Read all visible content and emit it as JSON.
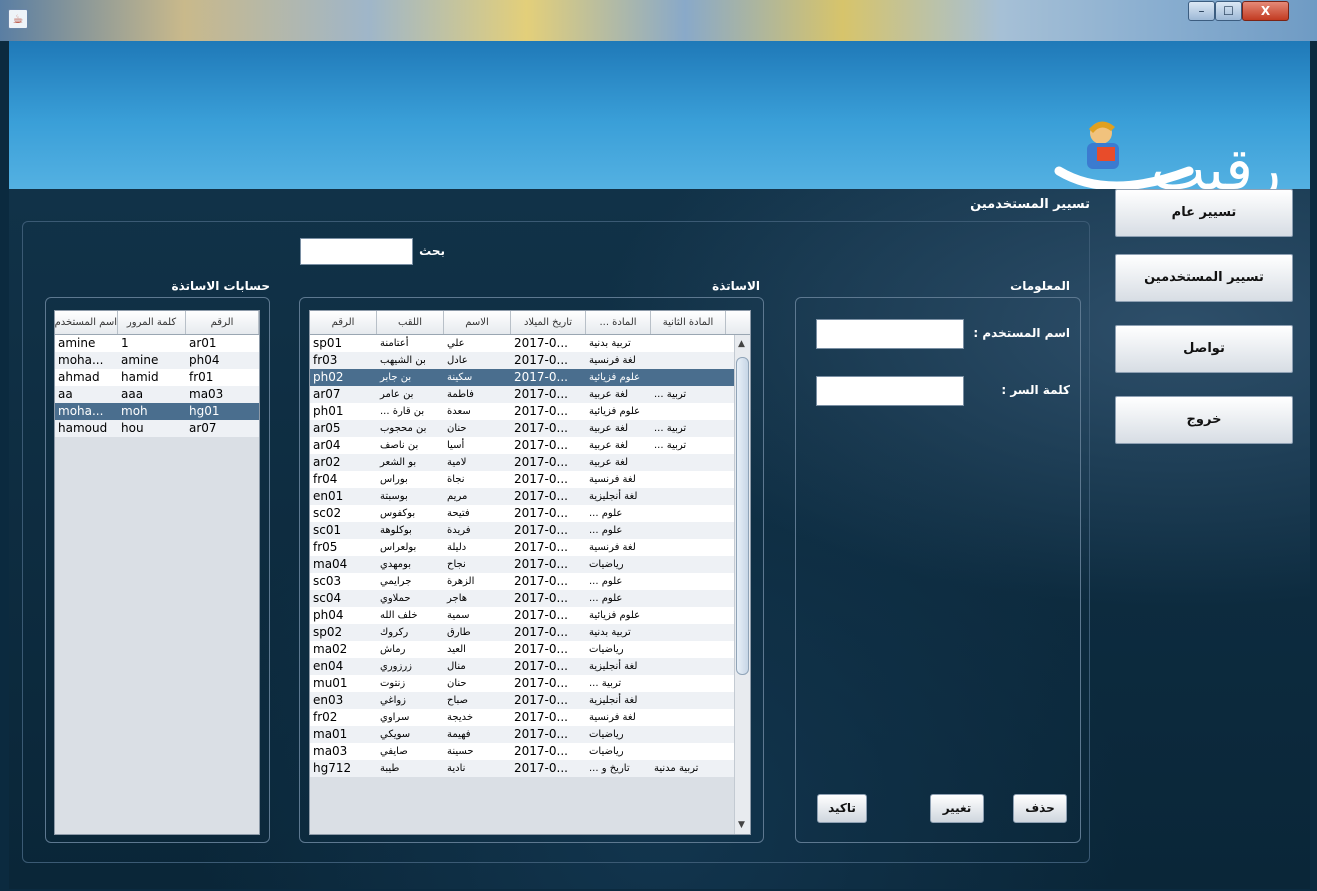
{
  "window": {
    "icon": "java-icon",
    "min": "–",
    "max": "☐",
    "close": "X"
  },
  "header": {
    "logo_text": "رقيب"
  },
  "nav": {
    "general": "تسيير عام",
    "users": "تسيير المستخدمين",
    "contact": "تواصل",
    "exit": "خروج"
  },
  "section_title": "تسيير المستخدمين",
  "search": {
    "label": "بحث",
    "value": ""
  },
  "info_panel": {
    "title": "المعلومات",
    "username_label": "اسم المستخدم :",
    "password_label": "كلمة السر :",
    "username_value": "",
    "password_value": "",
    "delete": "حذف",
    "change": "تغيير",
    "confirm": "تاكيد"
  },
  "teachers": {
    "title": "الاساتذة",
    "columns": [
      "الرقم",
      "اللقب",
      "الاسم",
      "تاريخ الميلاد",
      "المادة ...",
      "المادة الثانية"
    ],
    "rows": [
      [
        "sp01",
        "أعتامنة",
        "علي",
        "2017-0...",
        "تربية بدنية",
        ""
      ],
      [
        "fr03",
        "بن الشيهب",
        "عادل",
        "2017-0...",
        "لغة فرنسية",
        ""
      ],
      [
        "ph02",
        "بن جابر",
        "سكينة",
        "2017-0...",
        "علوم فزيائية",
        ""
      ],
      [
        "ar07",
        "بن عامر",
        "فاطمة",
        "2017-0...",
        "لغة عربية",
        "تربية ..."
      ],
      [
        "ph01",
        "بن قارة ...",
        "سعدة",
        "2017-0...",
        "علوم فزيائية",
        ""
      ],
      [
        "ar05",
        "بن محجوب",
        "حنان",
        "2017-0...",
        "لغة عربية",
        "تربية ..."
      ],
      [
        "ar04",
        "بن ناصف",
        "أسيا",
        "2017-0...",
        "لغة عربية",
        "تربية ..."
      ],
      [
        "ar02",
        "بو الشعر",
        "لامية",
        "2017-0...",
        "لغة عربية",
        ""
      ],
      [
        "fr04",
        "بوراس",
        "نجاة",
        "2017-0...",
        "لغة فرنسية",
        ""
      ],
      [
        "en01",
        "بوسبتة",
        "مريم",
        "2017-0...",
        "لغة أنجليزية",
        ""
      ],
      [
        "sc02",
        "بوكفوس",
        "فتيحة",
        "2017-0...",
        "علوم ...",
        ""
      ],
      [
        "sc01",
        "بوكلوهة",
        "فريدة",
        "2017-0...",
        "علوم ...",
        ""
      ],
      [
        "fr05",
        "بولعراس",
        "دليلة",
        "2017-0...",
        "لغة فرنسية",
        ""
      ],
      [
        "ma04",
        "بومهدي",
        "نجاح",
        "2017-0...",
        "رياضيات",
        ""
      ],
      [
        "sc03",
        "جرايمي",
        "الزهرة",
        "2017-0...",
        "علوم ...",
        ""
      ],
      [
        "sc04",
        "حملاوي",
        "هاجر",
        "2017-0...",
        "علوم ...",
        ""
      ],
      [
        "ph04",
        "خلف الله",
        "سمية",
        "2017-0...",
        "علوم فزيائية",
        ""
      ],
      [
        "sp02",
        "ركروك",
        "طارق",
        "2017-0...",
        "تربية بدنية",
        ""
      ],
      [
        "ma02",
        "رماش",
        "العيد",
        "2017-0...",
        "رياضيات",
        ""
      ],
      [
        "en04",
        "زرزوري",
        "منال",
        "2017-0...",
        "لغة أنجليزية",
        ""
      ],
      [
        "mu01",
        "زنتوت",
        "حنان",
        "2017-0...",
        "تربية ...",
        ""
      ],
      [
        "en03",
        "زواغي",
        "صباح",
        "2017-0...",
        "لغة أنجليزية",
        ""
      ],
      [
        "fr02",
        "سراوي",
        "خديجة",
        "2017-0...",
        "لغة فرنسية",
        ""
      ],
      [
        "ma01",
        "سويكي",
        "فهيمة",
        "2017-0...",
        "رياضيات",
        ""
      ],
      [
        "ma03",
        "صايفي",
        "حسينة",
        "2017-0...",
        "رياضيات",
        ""
      ],
      [
        "hg712",
        "طيبة",
        "نادية",
        "2017-0...",
        "تاريخ و ...",
        "تربية مدنية"
      ]
    ],
    "selected_index": 2
  },
  "accounts": {
    "title": "حسابات الاساتذة",
    "columns": [
      "الرقم",
      "كلمة المرور",
      "اسم المستخدم"
    ],
    "rows": [
      [
        "amine",
        "1",
        "ar01"
      ],
      [
        "moha...",
        "amine",
        "ph04"
      ],
      [
        "ahmad",
        "hamid",
        "fr01"
      ],
      [
        "aa",
        "aaa",
        "ma03"
      ],
      [
        "moha...",
        "moh",
        "hg01"
      ],
      [
        "hamoud",
        "hou",
        "ar07"
      ]
    ],
    "selected_index": 4
  },
  "colors": {
    "accent": "#4a6e8e",
    "header": "#2e8cc9",
    "background": "#0b2a3f"
  }
}
